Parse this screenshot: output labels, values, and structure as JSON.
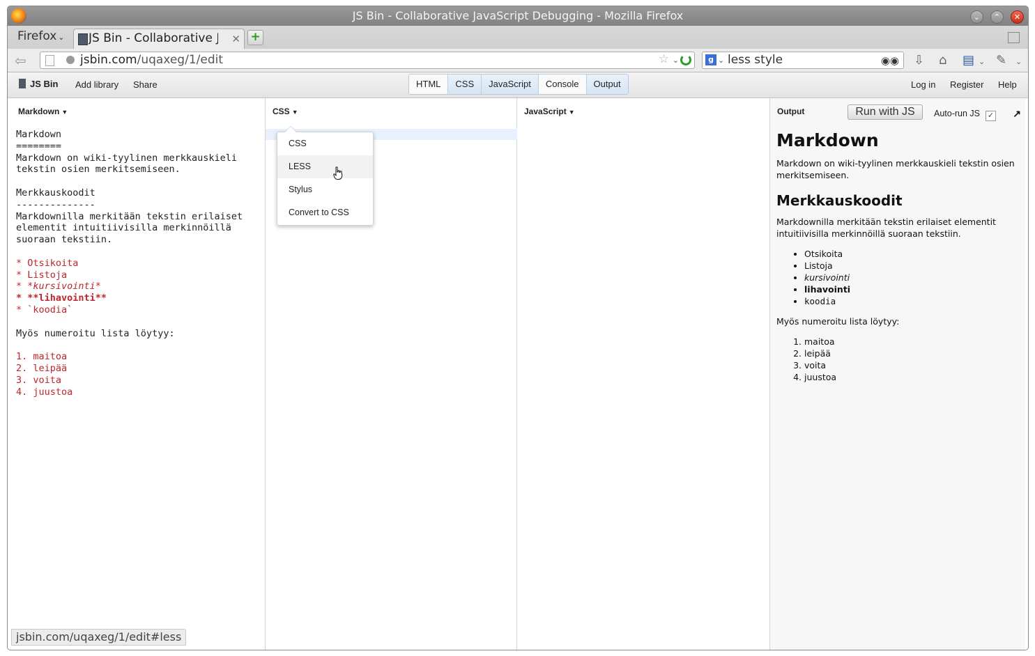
{
  "window": {
    "title": "JS Bin - Collaborative JavaScript Debugging - Mozilla Firefox"
  },
  "tabs": {
    "menu_label": "Firefox",
    "active_tab_title": "JS Bin - Collaborative Jav..."
  },
  "nav": {
    "url_host": "jsbin.com",
    "url_path": "/uqaxeg/1/edit",
    "search_engine": "g",
    "search_query": "less style"
  },
  "jsbin": {
    "brand": "JS Bin",
    "add_library": "Add library",
    "share": "Share",
    "panels": [
      "HTML",
      "CSS",
      "JavaScript",
      "Console",
      "Output"
    ],
    "active_panels": [
      "CSS",
      "JavaScript",
      "Output"
    ],
    "login": "Log in",
    "register": "Register",
    "help": "Help"
  },
  "markdown_panel": {
    "title": "Markdown",
    "lines": [
      "Markdown",
      "========",
      "Markdown on wiki-tyylinen merkkauskieli",
      "tekstin osien merkitsemiseen.",
      "",
      "Merkkauskoodit",
      "--------------",
      "Markdownilla merkitään tekstin erilaiset",
      "elementit intuitiivisilla merkinnöillä",
      "suoraan tekstiin.",
      "",
      "* Otsikoita",
      "* Listoja",
      "* *kursivointi*",
      "* **lihavointi**",
      "* `koodia`",
      "",
      "Myös numeroitu lista löytyy:",
      "",
      "1. maitoa",
      "2. leipää",
      "3. voita",
      "4. juustoa"
    ]
  },
  "css_panel": {
    "title": "CSS",
    "menu": [
      "CSS",
      "LESS",
      "Stylus",
      "Convert to CSS"
    ],
    "hovered": "LESS"
  },
  "js_panel": {
    "title": "JavaScript"
  },
  "output_panel": {
    "title": "Output",
    "run_button": "Run with JS",
    "autorun_label": "Auto-run JS",
    "autorun_checked": true,
    "h1": "Markdown",
    "p1": "Markdown on wiki-tyylinen merkkauskieli tekstin osien merkitsemiseen.",
    "h2": "Merkkauskoodit",
    "p2": "Markdownilla merkitään tekstin erilaiset elementit intuitiivisilla merkinnöillä suoraan tekstiin.",
    "bullets": [
      "Otsikoita",
      "Listoja",
      "kursivointi",
      "lihavointi",
      "koodia"
    ],
    "p3": "Myös numeroitu lista löytyy:",
    "numbered": [
      "maitoa",
      "leipää",
      "voita",
      "juustoa"
    ]
  },
  "statusbar": {
    "text": "jsbin.com/uqaxeg/1/edit#less"
  }
}
